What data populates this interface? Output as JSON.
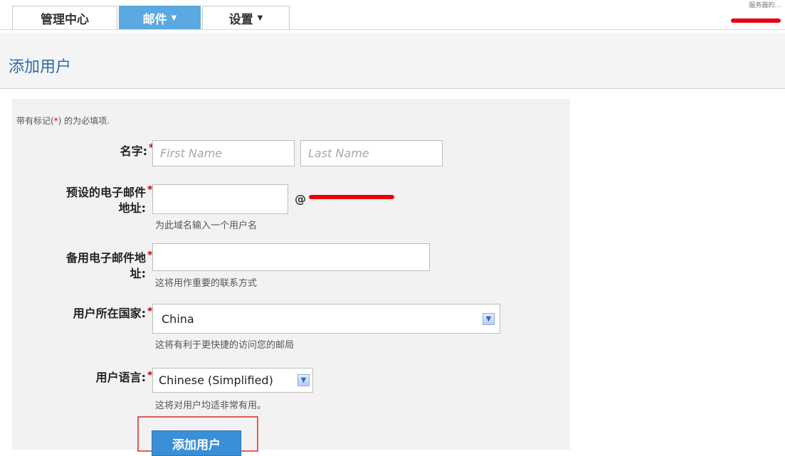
{
  "tabs": [
    {
      "label": "管理中心",
      "caret": ""
    },
    {
      "label": "邮件",
      "caret": "▼"
    },
    {
      "label": "设置",
      "caret": "▼"
    }
  ],
  "user_area": {
    "text": "服务器的..."
  },
  "header": {
    "title": "添加用户"
  },
  "form": {
    "required_note_prefix": "带有标记(",
    "required_star": "*",
    "required_note_suffix": ") 的为必填项.",
    "name": {
      "label": "名字:",
      "first_placeholder": "First Name",
      "last_placeholder": "Last Name"
    },
    "email": {
      "label_line1": "预设的电子邮件",
      "label_line2": "地址:",
      "value": "",
      "at": "@",
      "hint": "为此域名输入一个用户名"
    },
    "alt_email": {
      "label_line1": "备用电子邮件地",
      "label_line2": "址:",
      "value": "",
      "hint": "这将用作重要的联系方式"
    },
    "country": {
      "label": "用户所在国家:",
      "value": "China",
      "hint": "这将有利于更快捷的访问您的邮局"
    },
    "language": {
      "label": "用户语言:",
      "value": "Chinese (Simplified)",
      "hint": "这将对用户均适非常有用。"
    },
    "submit_label": "添加用户"
  },
  "colors": {
    "accent": "#5aa9e0",
    "title": "#2a6ea8",
    "required": "#d40000",
    "button": "#3b8fd6"
  },
  "icons": {
    "dropdown": "chevron-down-icon"
  }
}
